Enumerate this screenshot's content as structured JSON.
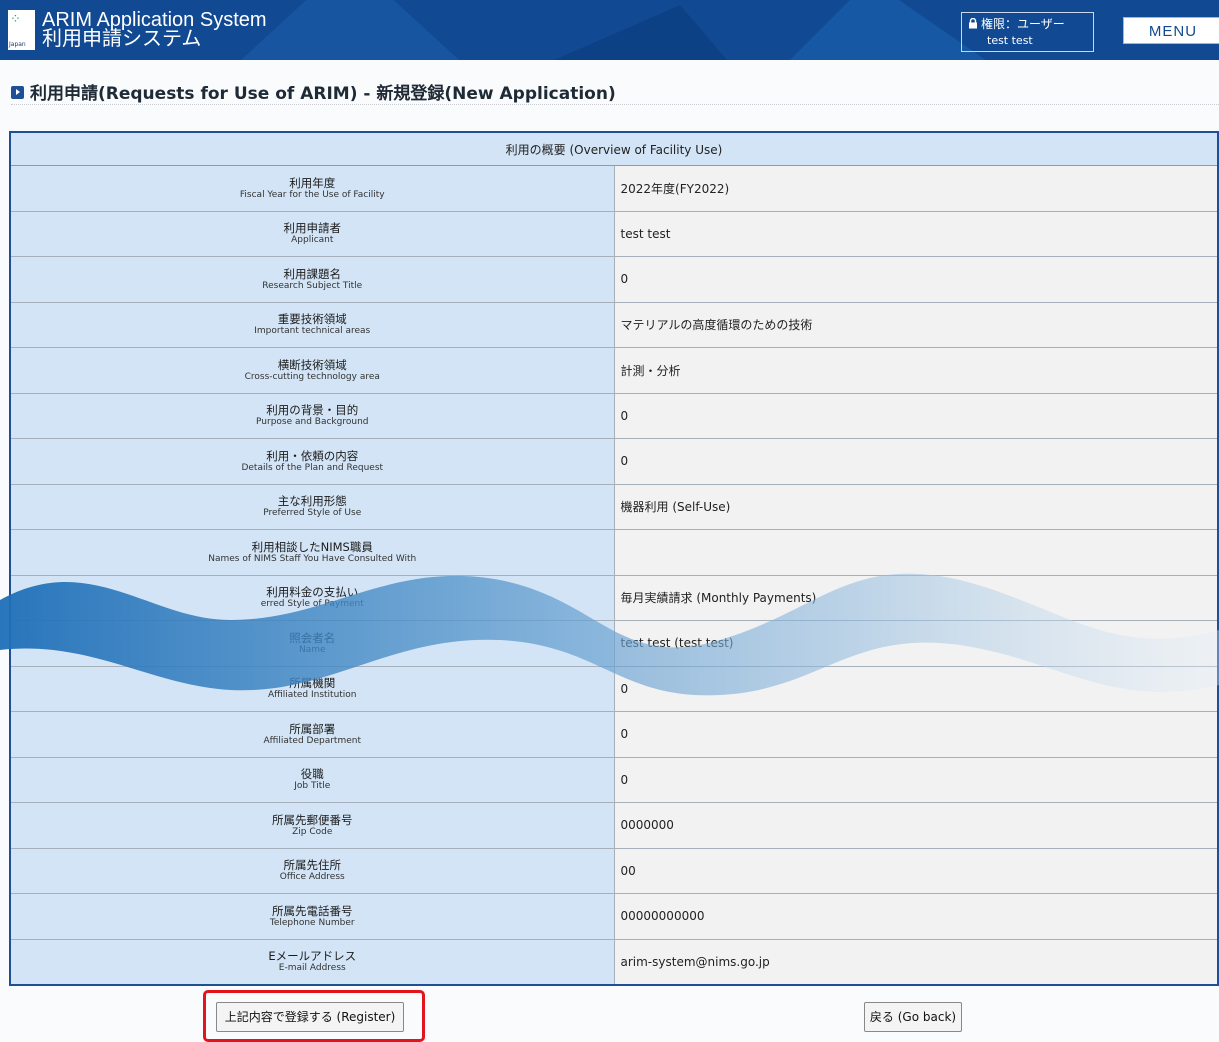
{
  "header": {
    "logo_text": "Japan",
    "title_en": "ARIM Application System",
    "title_ja": "利用申請システム",
    "role_label": "権限：ユーザー",
    "user_name": "test test",
    "menu_label": "MENU"
  },
  "page": {
    "heading": "利用申請(Requests for Use of ARIM) - 新規登録(New Application)"
  },
  "table": {
    "caption": "利用の概要 (Overview of Facility Use)",
    "rows": [
      {
        "label_ja": "利用年度",
        "label_en": "Fiscal Year for the Use of Facility",
        "value": "2022年度(FY2022)"
      },
      {
        "label_ja": "利用申請者",
        "label_en": "Applicant",
        "value": "test test"
      },
      {
        "label_ja": "利用課題名",
        "label_en": "Research Subject Title",
        "value": "0"
      },
      {
        "label_ja": "重要技術領域",
        "label_en": "Important technical areas",
        "value": "マテリアルの高度循環のための技術"
      },
      {
        "label_ja": "横断技術領域",
        "label_en": "Cross-cutting technology area",
        "value": "計測・分析"
      },
      {
        "label_ja": "利用の背景・目的",
        "label_en": "Purpose and Background",
        "value": "0"
      },
      {
        "label_ja": "利用・依頼の内容",
        "label_en": "Details of the Plan and Request",
        "value": "0"
      },
      {
        "label_ja": "主な利用形態",
        "label_en": "Preferred Style of Use",
        "value": "機器利用 (Self-Use)"
      },
      {
        "label_ja": "利用相談したNIMS職員",
        "label_en": "Names of NIMS Staff You Have Consulted With",
        "value": ""
      },
      {
        "label_ja": "利用料金の支払い",
        "label_en": "erred Style of Payment",
        "value": "毎月実績請求 (Monthly Payments)"
      },
      {
        "label_ja": "照会者名",
        "label_en": "Name",
        "value": "test test (test test)"
      },
      {
        "label_ja": "所属機関",
        "label_en": "Affiliated Institution",
        "value": "0"
      },
      {
        "label_ja": "所属部署",
        "label_en": "Affiliated Department",
        "value": "0"
      },
      {
        "label_ja": "役職",
        "label_en": "Job Title",
        "value": "0"
      },
      {
        "label_ja": "所属先郵便番号",
        "label_en": "Zip Code",
        "value": "0000000"
      },
      {
        "label_ja": "所属先住所",
        "label_en": "Office Address",
        "value": "00"
      },
      {
        "label_ja": "所属先電話番号",
        "label_en": "Telephone Number",
        "value": "00000000000"
      },
      {
        "label_ja": "Eメールアドレス",
        "label_en": "E-mail Address",
        "value": "arim-system@nims.go.jp"
      }
    ]
  },
  "actions": {
    "register_label": "上記内容で登録する (Register)",
    "back_label": "戻る (Go back)"
  },
  "colors": {
    "header_bg": "#114a92",
    "label_bg": "#d2e4f5",
    "value_bg": "#f2f2f2",
    "highlight": "#e3141c"
  }
}
